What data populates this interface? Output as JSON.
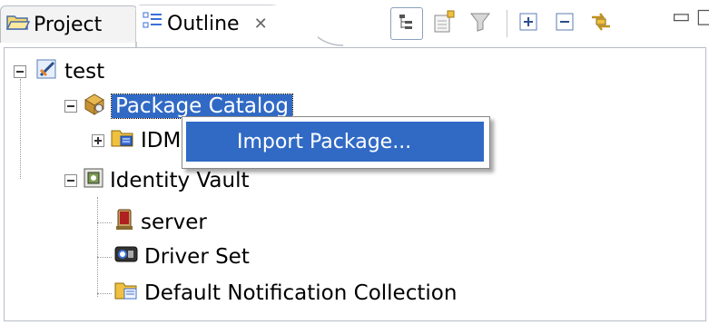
{
  "tabs": {
    "project_label": "Project",
    "outline_label": "Outline",
    "outline_close": "✕"
  },
  "toolbar": {
    "minimize": "▭",
    "maximize": "□"
  },
  "tree": {
    "root": "test",
    "package_catalog": "Package Catalog",
    "idm": "IDM",
    "identity_vault": "Identity Vault",
    "server": "server",
    "driver_set": "Driver Set",
    "notification": "Default Notification Collection"
  },
  "context_menu": {
    "import_package": "Import Package..."
  },
  "colors": {
    "selection": "#316ac5",
    "tab_border": "#b7bcc6"
  }
}
